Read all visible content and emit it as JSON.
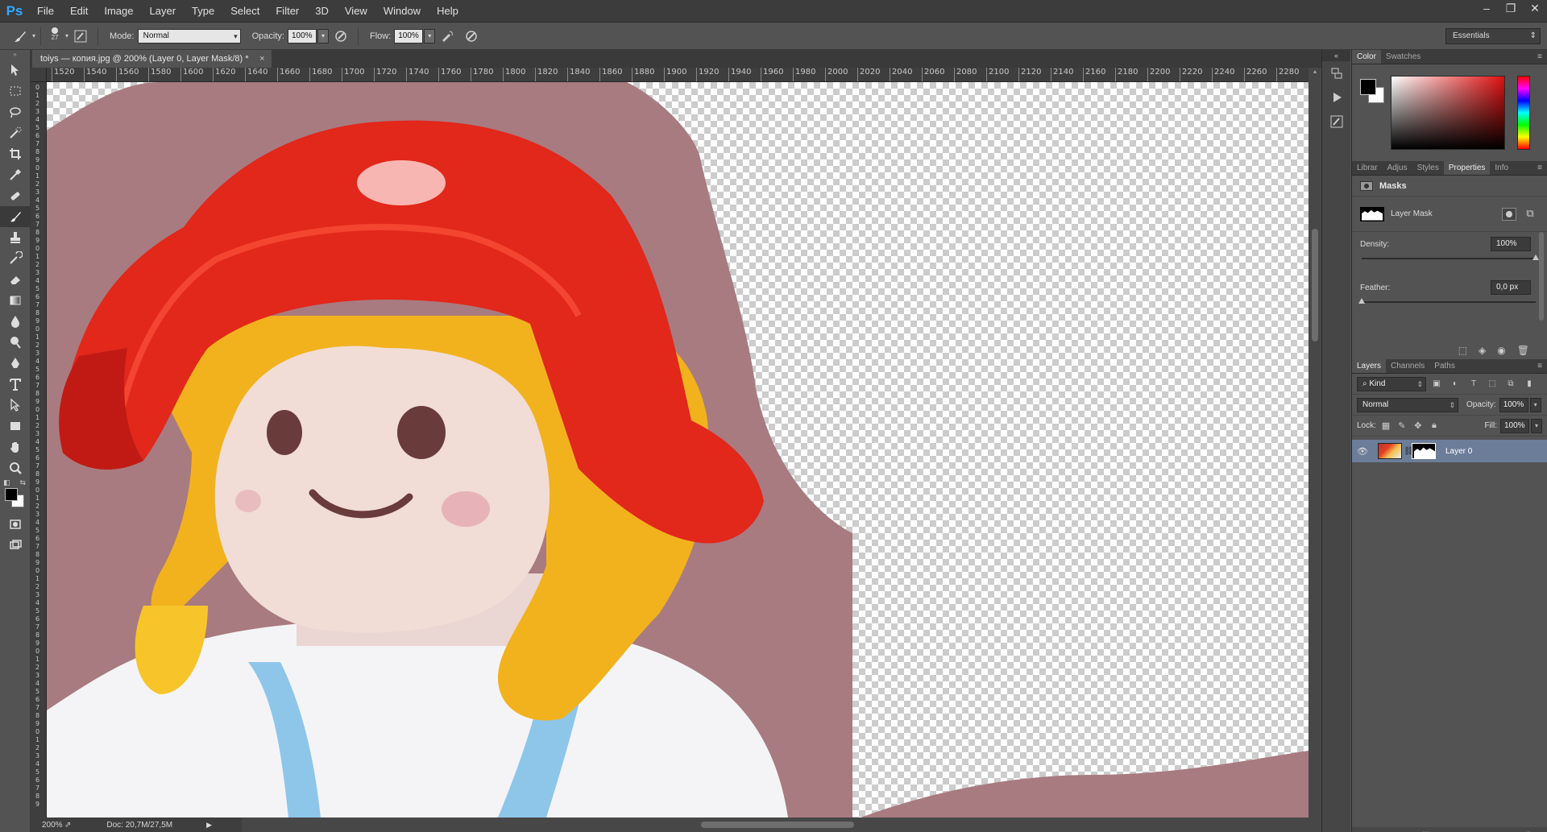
{
  "app": {
    "logo": "Ps"
  },
  "menu": [
    "File",
    "Edit",
    "Image",
    "Layer",
    "Type",
    "Select",
    "Filter",
    "3D",
    "View",
    "Window",
    "Help"
  ],
  "window_controls": {
    "minimize": "–",
    "restore": "❐",
    "close": "✕"
  },
  "options": {
    "brush_size": "27",
    "mode_label": "Mode:",
    "mode_value": "Normal",
    "opacity_label": "Opacity:",
    "opacity_value": "100%",
    "flow_label": "Flow:",
    "flow_value": "100%",
    "workspace": "Essentials"
  },
  "document": {
    "tab_title": "toiys — копия.jpg @ 200% (Layer 0, Layer Mask/8) *",
    "tab_close": "×",
    "ruler_h": [
      "1520",
      "1540",
      "1560",
      "1580",
      "1600",
      "1620",
      "1640",
      "1660",
      "1680",
      "1700",
      "1720",
      "1740",
      "1760",
      "1780",
      "1800",
      "1820",
      "1840",
      "1860",
      "1880",
      "1900",
      "1920",
      "1940",
      "1960",
      "1980",
      "2000",
      "2020",
      "2040",
      "2060",
      "2080",
      "2100",
      "2120",
      "2140",
      "2160",
      "2180",
      "2200",
      "2220",
      "2240",
      "2260",
      "2280"
    ],
    "ruler_v": [
      "0",
      "1",
      "2",
      "3",
      "4",
      "5",
      "6",
      "7",
      "8",
      "9",
      "0",
      "1",
      "2",
      "3",
      "4",
      "5",
      "6",
      "7",
      "8",
      "9",
      "0",
      "1",
      "2",
      "3",
      "4",
      "5",
      "6",
      "7",
      "8",
      "9",
      "0",
      "1",
      "2",
      "3",
      "4",
      "5",
      "6",
      "7",
      "8",
      "9",
      "0",
      "1",
      "2",
      "3",
      "4",
      "5",
      "6",
      "7",
      "8",
      "9",
      "0",
      "1",
      "2",
      "3",
      "4",
      "5",
      "6",
      "7",
      "8",
      "9",
      "0",
      "1",
      "2",
      "3",
      "4",
      "5",
      "6",
      "7",
      "8",
      "9",
      "0",
      "1",
      "2",
      "3",
      "4",
      "5",
      "6",
      "7",
      "8",
      "9",
      "0",
      "1",
      "2",
      "3",
      "4",
      "5",
      "6",
      "7",
      "8",
      "9"
    ]
  },
  "status": {
    "zoom": "200%",
    "doc_size": "Doc: 20,7M/27,5M"
  },
  "tools": [
    "move-tool",
    "marquee-tool",
    "lasso-tool",
    "quick-select-tool",
    "crop-tool",
    "eyedropper-tool",
    "healing-brush-tool",
    "brush-tool",
    "clone-stamp-tool",
    "history-brush-tool",
    "eraser-tool",
    "gradient-tool",
    "blur-tool",
    "dodge-tool",
    "pen-tool",
    "type-tool",
    "path-select-tool",
    "shape-tool",
    "hand-tool",
    "zoom-tool"
  ],
  "color_panel": {
    "tabs": [
      "Color",
      "Swatches"
    ],
    "foreground": "#000000",
    "background": "#ffffff"
  },
  "properties_panel": {
    "tabs": [
      "Librar",
      "Adjus",
      "Styles",
      "Properties",
      "Info"
    ],
    "section": "Masks",
    "mask_name": "Layer Mask",
    "density_label": "Density:",
    "density_value": "100%",
    "feather_label": "Feather:",
    "feather_value": "0,0 px"
  },
  "layers_panel": {
    "tabs": [
      "Layers",
      "Channels",
      "Paths"
    ],
    "filter_kind": "Kind",
    "blend_mode": "Normal",
    "opacity_label": "Opacity:",
    "opacity_value": "100%",
    "lock_label": "Lock:",
    "fill_label": "Fill:",
    "fill_value": "100%",
    "layers": [
      {
        "name": "Layer 0",
        "visible": true,
        "selected": true
      }
    ]
  },
  "colors": {
    "accent": "#31a8ff",
    "selected_layer": "#6c7d99",
    "panel_bg": "#535353",
    "hat_red": "#e2271b",
    "hair_yellow": "#f2b21e"
  }
}
